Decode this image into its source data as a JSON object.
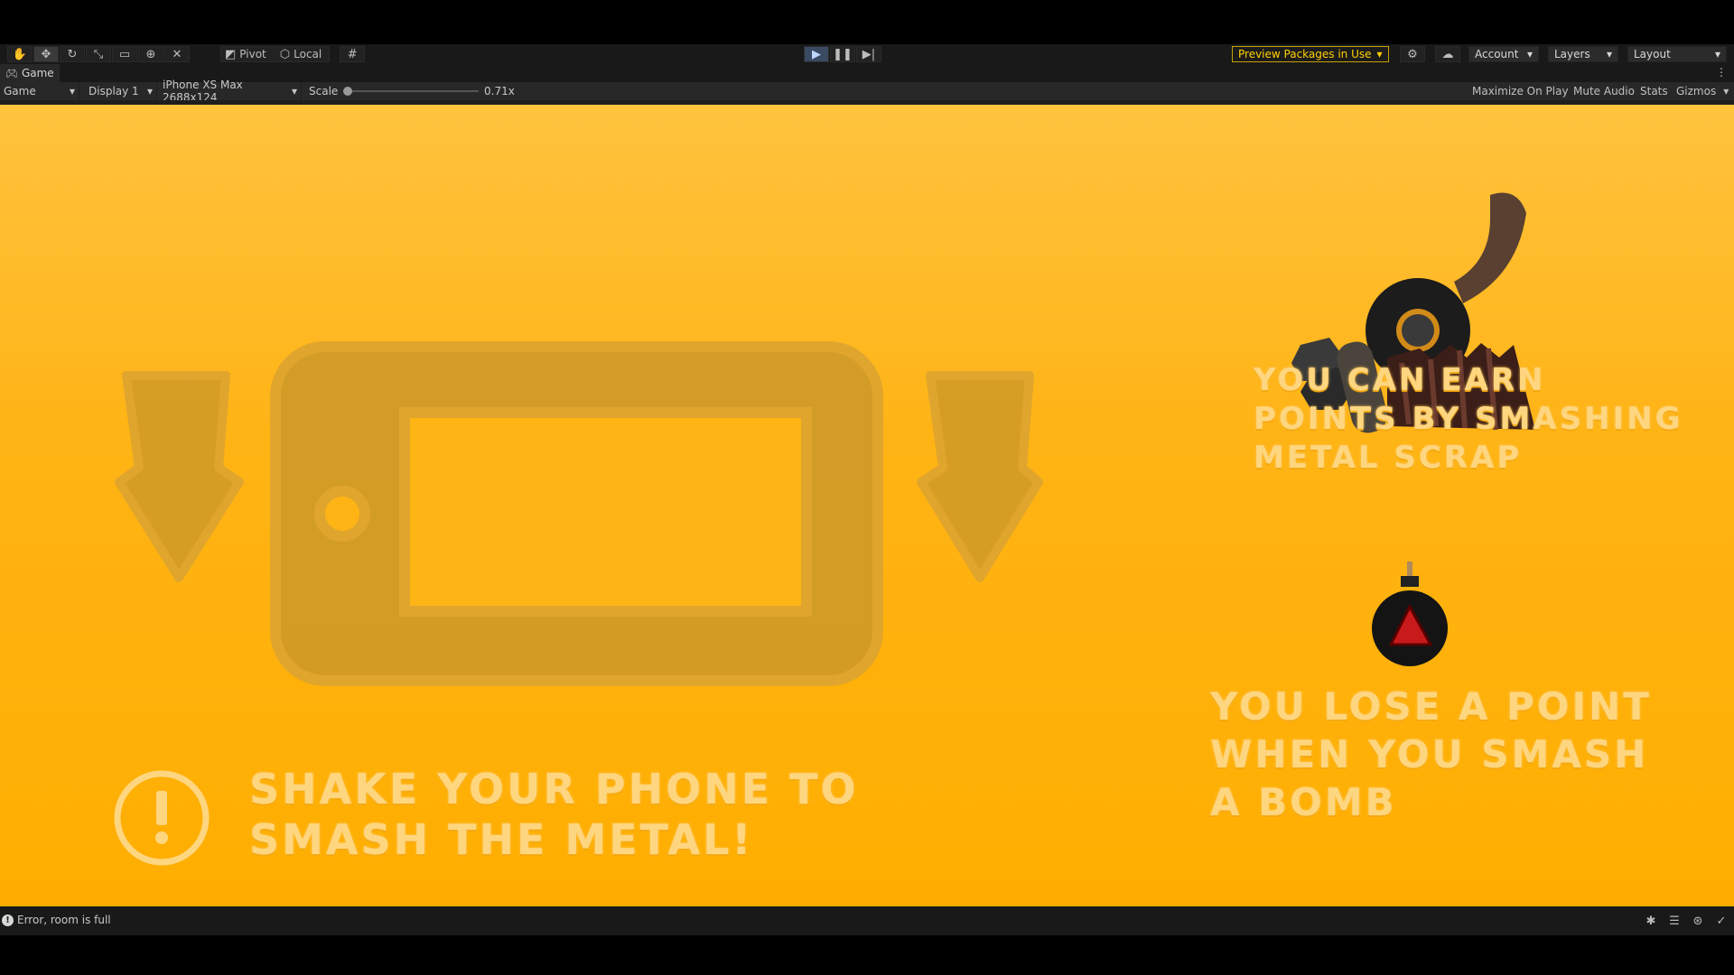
{
  "toolbar": {
    "pivot_label": "Pivot",
    "local_label": "Local",
    "preview_packages_label": "Preview Packages in Use",
    "account_label": "Account",
    "layers_label": "Layers",
    "layout_label": "Layout"
  },
  "tab": {
    "title": "Game"
  },
  "game_toolbar": {
    "mode": "Game",
    "display": "Display 1",
    "device": "iPhone XS Max 2688x124",
    "scale_label": "Scale",
    "scale_value": "0.71x",
    "scale_fraction": 0.0,
    "maximize_label": "Maximize On Play",
    "mute_label": "Mute Audio",
    "stats_label": "Stats",
    "gizmos_label": "Gizmos"
  },
  "game": {
    "instruction_line1": "Shake your phone to",
    "instruction_line2": "smash the metal!",
    "scrap_line1": "You can earn",
    "scrap_line2": "points by smashing",
    "scrap_line3": "metal scrap",
    "bomb_line1": "You lose a point",
    "bomb_line2": "when you smash",
    "bomb_line3": "a bomb"
  },
  "status": {
    "message": "Error, room is full"
  },
  "colors": {
    "game_background": "#ffb416",
    "hint_text": "#ffd680",
    "phone_graphic": "#c8962a",
    "warning": "#ffd000"
  }
}
